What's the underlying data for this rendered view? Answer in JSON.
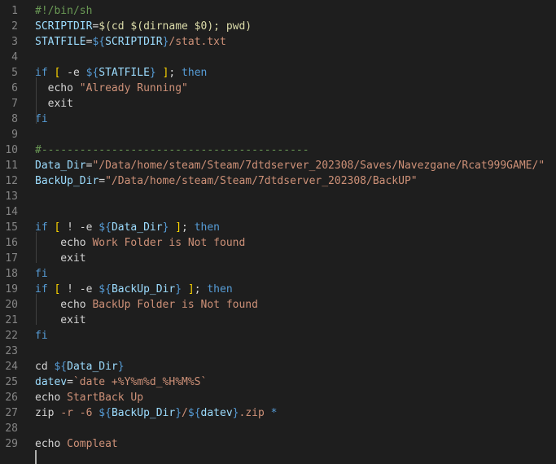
{
  "colors": {
    "background": "#1e1e1e",
    "line_number": "#858585",
    "default": "#d4d4d4",
    "keyword": "#569cd6",
    "variable": "#9cdcfe",
    "string": "#ce9178",
    "comment": "#6a9955",
    "operator": "#d4d4d4",
    "builtin": "#dcdcaa",
    "bracket": "#ffd700"
  },
  "editor": {
    "lines": [
      {
        "number": "1",
        "tokens": [
          {
            "text": "#!/bin/sh",
            "type": "comment"
          }
        ]
      },
      {
        "number": "2",
        "tokens": [
          {
            "text": "SCRIPTDIR",
            "type": "variable"
          },
          {
            "text": "=",
            "type": "operator"
          },
          {
            "text": "$(cd $(dirname $0); pwd)",
            "type": "builtin"
          }
        ]
      },
      {
        "number": "3",
        "tokens": [
          {
            "text": "STATFILE",
            "type": "variable"
          },
          {
            "text": "=",
            "type": "operator"
          },
          {
            "text": "${",
            "type": "keyword"
          },
          {
            "text": "SCRIPTDIR",
            "type": "variable"
          },
          {
            "text": "}",
            "type": "keyword"
          },
          {
            "text": "/stat.txt",
            "type": "string"
          }
        ]
      },
      {
        "number": "4",
        "tokens": []
      },
      {
        "number": "5",
        "tokens": [
          {
            "text": "if",
            "type": "keyword"
          },
          {
            "text": " ",
            "type": "default"
          },
          {
            "text": "[",
            "type": "bracket"
          },
          {
            "text": " -e ",
            "type": "default"
          },
          {
            "text": "${",
            "type": "keyword"
          },
          {
            "text": "STATFILE",
            "type": "variable"
          },
          {
            "text": "}",
            "type": "keyword"
          },
          {
            "text": " ",
            "type": "default"
          },
          {
            "text": "]",
            "type": "bracket"
          },
          {
            "text": "; ",
            "type": "default"
          },
          {
            "text": "then",
            "type": "keyword"
          }
        ]
      },
      {
        "number": "6",
        "tokens": [
          {
            "text": "  echo ",
            "type": "default"
          },
          {
            "text": "\"Already Running\"",
            "type": "string"
          }
        ]
      },
      {
        "number": "7",
        "tokens": [
          {
            "text": "  exit",
            "type": "default"
          }
        ]
      },
      {
        "number": "8",
        "tokens": [
          {
            "text": "fi",
            "type": "keyword"
          }
        ]
      },
      {
        "number": "9",
        "tokens": []
      },
      {
        "number": "10",
        "tokens": [
          {
            "text": "#------------------------------------------",
            "type": "comment"
          }
        ]
      },
      {
        "number": "11",
        "tokens": [
          {
            "text": "Data_Dir",
            "type": "variable"
          },
          {
            "text": "=",
            "type": "operator"
          },
          {
            "text": "\"/Data/home/steam/Steam/7dtdserver_202308/Saves/Navezgane/Rcat999GAME/\"",
            "type": "string"
          }
        ]
      },
      {
        "number": "12",
        "tokens": [
          {
            "text": "BackUp_Dir",
            "type": "variable"
          },
          {
            "text": "=",
            "type": "operator"
          },
          {
            "text": "\"/Data/home/steam/Steam/7dtdserver_202308/BackUP\"",
            "type": "string"
          }
        ]
      },
      {
        "number": "13",
        "tokens": []
      },
      {
        "number": "14",
        "tokens": []
      },
      {
        "number": "15",
        "tokens": [
          {
            "text": "if",
            "type": "keyword"
          },
          {
            "text": " ",
            "type": "default"
          },
          {
            "text": "[",
            "type": "bracket"
          },
          {
            "text": " ! -e ",
            "type": "default"
          },
          {
            "text": "${",
            "type": "keyword"
          },
          {
            "text": "Data_Dir",
            "type": "variable"
          },
          {
            "text": "}",
            "type": "keyword"
          },
          {
            "text": " ",
            "type": "default"
          },
          {
            "text": "]",
            "type": "bracket"
          },
          {
            "text": "; ",
            "type": "default"
          },
          {
            "text": "then",
            "type": "keyword"
          }
        ]
      },
      {
        "number": "16",
        "tokens": [
          {
            "text": "    echo ",
            "type": "default"
          },
          {
            "text": "Work Folder is Not found",
            "type": "string"
          }
        ]
      },
      {
        "number": "17",
        "tokens": [
          {
            "text": "    exit",
            "type": "default"
          }
        ]
      },
      {
        "number": "18",
        "tokens": [
          {
            "text": "fi",
            "type": "keyword"
          }
        ]
      },
      {
        "number": "19",
        "tokens": [
          {
            "text": "if",
            "type": "keyword"
          },
          {
            "text": " ",
            "type": "default"
          },
          {
            "text": "[",
            "type": "bracket"
          },
          {
            "text": " ! -e ",
            "type": "default"
          },
          {
            "text": "${",
            "type": "keyword"
          },
          {
            "text": "BackUp_Dir",
            "type": "variable"
          },
          {
            "text": "}",
            "type": "keyword"
          },
          {
            "text": " ",
            "type": "default"
          },
          {
            "text": "]",
            "type": "bracket"
          },
          {
            "text": "; ",
            "type": "default"
          },
          {
            "text": "then",
            "type": "keyword"
          }
        ]
      },
      {
        "number": "20",
        "tokens": [
          {
            "text": "    echo ",
            "type": "default"
          },
          {
            "text": "BackUp Folder is Not found",
            "type": "string"
          }
        ]
      },
      {
        "number": "21",
        "tokens": [
          {
            "text": "    exit",
            "type": "default"
          }
        ]
      },
      {
        "number": "22",
        "tokens": [
          {
            "text": "fi",
            "type": "keyword"
          }
        ]
      },
      {
        "number": "23",
        "tokens": []
      },
      {
        "number": "24",
        "tokens": [
          {
            "text": "cd ",
            "type": "default"
          },
          {
            "text": "${",
            "type": "keyword"
          },
          {
            "text": "Data_Dir",
            "type": "variable"
          },
          {
            "text": "}",
            "type": "keyword"
          }
        ]
      },
      {
        "number": "25",
        "tokens": [
          {
            "text": "datev",
            "type": "variable"
          },
          {
            "text": "=",
            "type": "operator"
          },
          {
            "text": "`date +%Y%m%d_%H%M%S`",
            "type": "string"
          }
        ]
      },
      {
        "number": "26",
        "tokens": [
          {
            "text": "echo ",
            "type": "default"
          },
          {
            "text": "StartBack Up",
            "type": "string"
          }
        ]
      },
      {
        "number": "27",
        "tokens": [
          {
            "text": "zip ",
            "type": "default"
          },
          {
            "text": "-r -6 ",
            "type": "string"
          },
          {
            "text": "${",
            "type": "keyword"
          },
          {
            "text": "BackUp_Dir",
            "type": "variable"
          },
          {
            "text": "}",
            "type": "keyword"
          },
          {
            "text": "/",
            "type": "string"
          },
          {
            "text": "${",
            "type": "keyword"
          },
          {
            "text": "datev",
            "type": "variable"
          },
          {
            "text": "}",
            "type": "keyword"
          },
          {
            "text": ".zip ",
            "type": "string"
          },
          {
            "text": "*",
            "type": "keyword"
          }
        ]
      },
      {
        "number": "28",
        "tokens": []
      },
      {
        "number": "29",
        "tokens": [
          {
            "text": "echo ",
            "type": "default"
          },
          {
            "text": "Compleat",
            "type": "string"
          }
        ]
      }
    ]
  }
}
